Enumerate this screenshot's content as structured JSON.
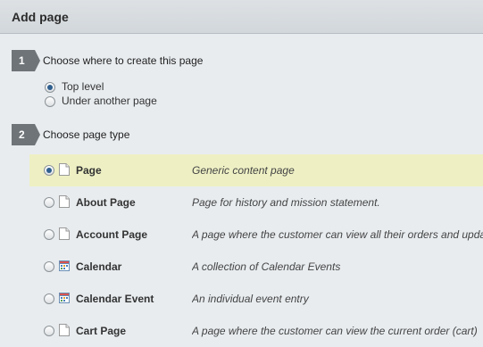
{
  "header": {
    "title": "Add page"
  },
  "step1": {
    "number": "1",
    "label": "Choose where to create this page",
    "options": [
      {
        "label": "Top level",
        "checked": true
      },
      {
        "label": "Under another page",
        "checked": false
      }
    ]
  },
  "step2": {
    "number": "2",
    "label": "Choose page type",
    "types": [
      {
        "name": "Page",
        "description": "Generic content page",
        "icon": "document-icon",
        "checked": true
      },
      {
        "name": "About Page",
        "description": "Page for history and mission statement.",
        "icon": "document-icon",
        "checked": false
      },
      {
        "name": "Account Page",
        "description": "A page where the customer can view all their orders and update their details.",
        "icon": "document-icon",
        "checked": false
      },
      {
        "name": "Calendar",
        "description": "A collection of Calendar Events",
        "icon": "calendar-icon",
        "checked": false
      },
      {
        "name": "Calendar Event",
        "description": "An individual event entry",
        "icon": "calendar-icon",
        "checked": false
      },
      {
        "name": "Cart Page",
        "description": "A page where the customer can view the current order (cart)",
        "icon": "document-icon",
        "checked": false
      }
    ]
  },
  "colors": {
    "selected_row": "#eef0c4",
    "badge": "#6e7478",
    "radio_dot": "#2f5f8f"
  }
}
